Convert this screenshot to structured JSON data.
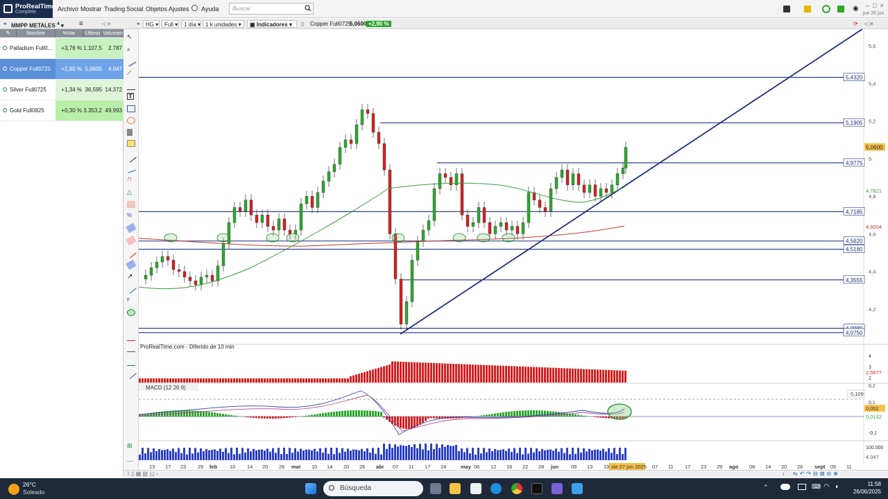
{
  "app": {
    "title_line1": "ProRealTime",
    "title_line2": "Complete",
    "menu": [
      "Archivo",
      "Mostrar",
      "Trading",
      "Social",
      "Objetos",
      "Ajustes",
      "Ayuda"
    ],
    "search_placeholder": "Buscar",
    "date_top": "jue 26 jun"
  },
  "toolbar": {
    "list_name": "MMPP METALES",
    "list_count": "4",
    "symbol": "HG",
    "range": "Full",
    "period": "1 día",
    "units": "1 k unidades",
    "indicators": "Indicadores",
    "instrument": "Copper Full0725",
    "price": "5,0600",
    "change": "+2,90 %"
  },
  "watchlist": {
    "headers": [
      "Nombre",
      "%Var",
      "Último",
      "Volumen"
    ],
    "rows": [
      {
        "name": "Palladium Full0...",
        "chg": "+3,76 %",
        "last": "1.107,5",
        "vol": "2.787",
        "selected": false,
        "green": false
      },
      {
        "name": "Copper Full0725",
        "chg": "+2,90 %",
        "last": "5,0600",
        "vol": "4.047",
        "selected": true,
        "green": false
      },
      {
        "name": "Silver Full0725",
        "chg": "+1,34 %",
        "last": "36,595",
        "vol": "14.372",
        "selected": false,
        "green": false
      },
      {
        "name": "Gold Full0825",
        "chg": "+0,30 %",
        "last": "3.353,2",
        "vol": "49.993",
        "selected": false,
        "green": true
      }
    ]
  },
  "chart": {
    "source_label": "ProRealTime.com - Diferido de 10 min",
    "macd_label": "MACD (12 26 9)",
    "price_axis_ticks": [
      "5,6",
      "5,4",
      "5,2",
      "5",
      "4,8",
      "4,6",
      "4,4",
      "4,2"
    ],
    "level_labels": [
      {
        "label": "5,4320",
        "price": 5.432
      },
      {
        "label": "5,1905",
        "price": 5.1905
      },
      {
        "label": "4,9775",
        "price": 4.9775
      },
      {
        "label": "4,7185",
        "price": 4.7185
      },
      {
        "label": "4,5620",
        "price": 4.562
      },
      {
        "label": "4,5180",
        "price": 4.518
      },
      {
        "label": "4,3555",
        "price": 4.3555
      },
      {
        "label": "4,0980",
        "price": 4.098
      },
      {
        "label": "4,0750",
        "price": 4.075
      }
    ],
    "current_price_label": "5,0600",
    "ma_fast_label": "4,7821",
    "ma_slow_label": "4,6004",
    "vol_panel_ticks": [
      "4",
      "3",
      "2"
    ],
    "vol_panel_value": "2,5677",
    "macd_ticks": [
      "0,2",
      "0,1",
      "-0,1"
    ],
    "macd_values": [
      "0,109",
      "0,052",
      "0,0132"
    ],
    "volume_ticks": [
      "100.000"
    ],
    "volume_value": "4.047",
    "date_axis": [
      "13",
      "17",
      "23",
      "29",
      "feb",
      "10",
      "14",
      "20",
      "26",
      "mar",
      "10",
      "14",
      "20",
      "26",
      "abr",
      "07",
      "11",
      "17",
      "24",
      "may",
      "06",
      "12",
      "16",
      "22",
      "28",
      "jun",
      "09",
      "13",
      "19",
      "vie 27 jun 2025",
      "07",
      "11",
      "17",
      "23",
      "29",
      "ago",
      "08",
      "14",
      "20",
      "26",
      "sept",
      "05",
      "11"
    ]
  },
  "taskbar": {
    "temp": "26°C",
    "weather": "Soleado",
    "search": "Búsqueda",
    "time": "11:58",
    "date": "26/06/2025"
  },
  "colors": {
    "up": "#2da82d",
    "down": "#d42020",
    "level_line": "#1a2d7a",
    "ma_fast": "#3a9a3a",
    "ma_slow": "#c0392b",
    "selected_row": "#5a8fd8",
    "taskbar": "#1e2a3a"
  }
}
